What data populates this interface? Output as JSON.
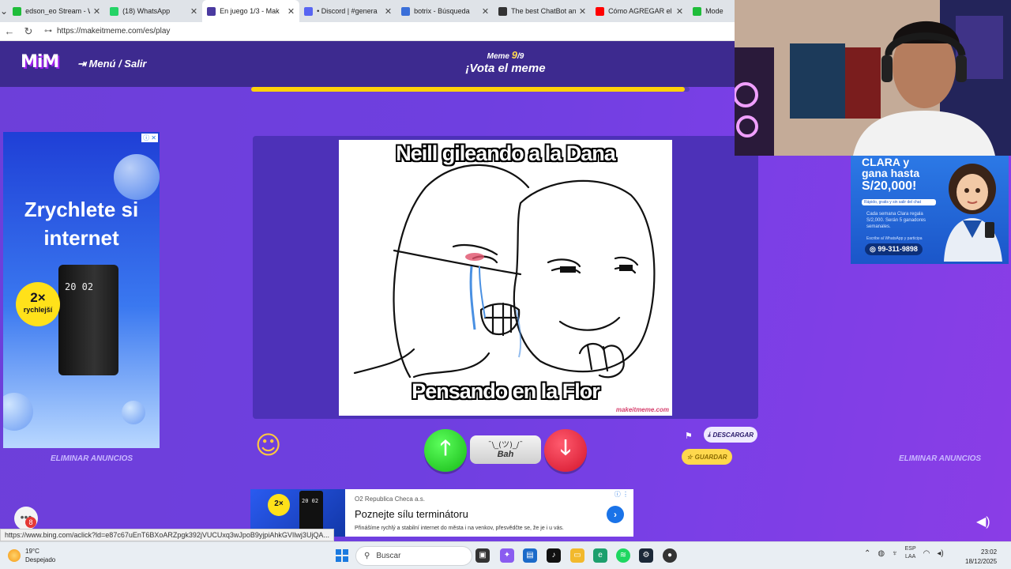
{
  "browser": {
    "tabs": [
      {
        "title": "edson_eo Stream - Wat",
        "favicon_color": "#1fbd3a",
        "active": false
      },
      {
        "title": "(18) WhatsApp",
        "favicon_color": "#25d366",
        "active": false
      },
      {
        "title": "En juego 1/3 - Mak",
        "favicon_color": "#4a3aa0",
        "active": true
      },
      {
        "title": "• Discord | #genera",
        "favicon_color": "#5865f2",
        "active": false
      },
      {
        "title": "botrix - Búsqueda",
        "favicon_color": "#3a6fd9",
        "active": false
      },
      {
        "title": "The best ChatBot and W",
        "favicon_color": "#333333",
        "active": false
      },
      {
        "title": "Cómo AGREGAR el CHA",
        "favicon_color": "#ff0000",
        "active": false
      },
      {
        "title": "Mode",
        "favicon_color": "#1fbd3a",
        "active": false
      }
    ],
    "url": "https://makeitmeme.com/es/play"
  },
  "header": {
    "logo": "MiM",
    "menu_label": "Menú / Salir",
    "round_label": "Meme",
    "round_current": "9",
    "round_total": "/9",
    "title": "¡Vota el meme"
  },
  "progress": {
    "fraction": 0.99
  },
  "left_ad": {
    "title": "Zrychlete si internet",
    "badge_big": "2×",
    "badge_small": "rychlejší",
    "device_text": "20 02"
  },
  "right_ad": {
    "line1": "CLARA y",
    "line2": "gana hasta",
    "amount": "S/20,000!",
    "small": "Rápido, gratis y sin salir del chat",
    "info": "Cada semana Clara regala S/2,000. Serán 5 ganadores semanales.",
    "cta": "Escribe al WhatsApp y participa",
    "phone": "99-311-9898"
  },
  "remove_ads_label": "ELIMINAR ANUNCIOS",
  "meme": {
    "top_text": "Neill gileando a la Dana",
    "bottom_text": "Pensando en la Flor",
    "watermark": "makeitmeme.com"
  },
  "vote": {
    "up_symbol": "🡑",
    "down_symbol": "🡓",
    "bah_face": "¯\\_(ツ)_/¯",
    "bah_label": "Bah",
    "download_label": "DESCARGAR",
    "save_label": "GUARDAR"
  },
  "bottom_ad": {
    "advertiser": "O2 Republica Checa a.s.",
    "headline": "Poznejte sílu terminátoru",
    "body": "Přinášíme rychlý a stabilní internet do města i na venkov, přesvědčte se, že je i u vás.",
    "badge": "2×",
    "device_text": "20 02"
  },
  "chat_badge_count": "8",
  "status_url": "https://www.bing.com/aclick?ld=e87c67uEnT6BXoARZpgk392jVUCUxq3wJpoB9yjpiAhkGVIlwj3UjQA...",
  "taskbar": {
    "temperature": "19°C",
    "weather": "Despejado",
    "search_placeholder": "Buscar",
    "lang_top": "ESP",
    "lang_bottom": "LAA",
    "time": "23:02",
    "date": "18/12/2025"
  }
}
